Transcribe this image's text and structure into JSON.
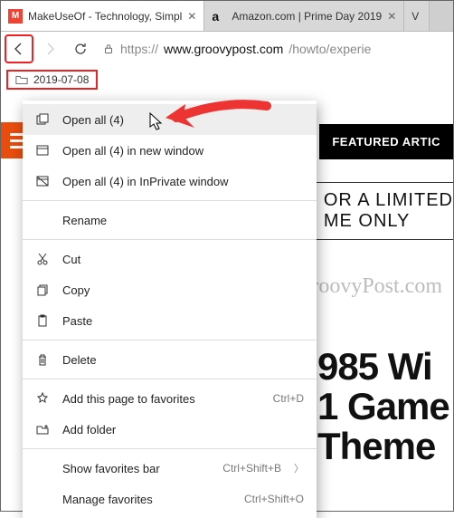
{
  "tabs": [
    {
      "title": "MakeUseOf - Technology, Simpl",
      "favicon": "M"
    },
    {
      "title": "Amazon.com | Prime Day 2019",
      "favicon": "a"
    },
    {
      "title": "V"
    }
  ],
  "url": {
    "scheme": "https://",
    "host": "www.groovypost.com",
    "path": "/howto/experie"
  },
  "fav_folder": {
    "label": "2019-07-08"
  },
  "page": {
    "nav_pill": "FEATURED ARTIC",
    "promo_line1": "OR A LIMITED",
    "promo_line2": "ME ONLY",
    "watermark": "groovyPost.com",
    "headline_l1": "985 Wi",
    "headline_l2": "1 Game",
    "headline_l3": "Theme"
  },
  "ctx": {
    "open_all": "Open all (4)",
    "open_all_new": "Open all (4) in new window",
    "open_all_priv": "Open all (4) in InPrivate window",
    "rename": "Rename",
    "cut": "Cut",
    "copy": "Copy",
    "paste": "Paste",
    "delete": "Delete",
    "add_page": "Add this page to favorites",
    "add_page_sc": "Ctrl+D",
    "add_folder": "Add folder",
    "show_bar": "Show favorites bar",
    "show_bar_sc": "Ctrl+Shift+B",
    "manage": "Manage favorites",
    "manage_sc": "Ctrl+Shift+O"
  }
}
